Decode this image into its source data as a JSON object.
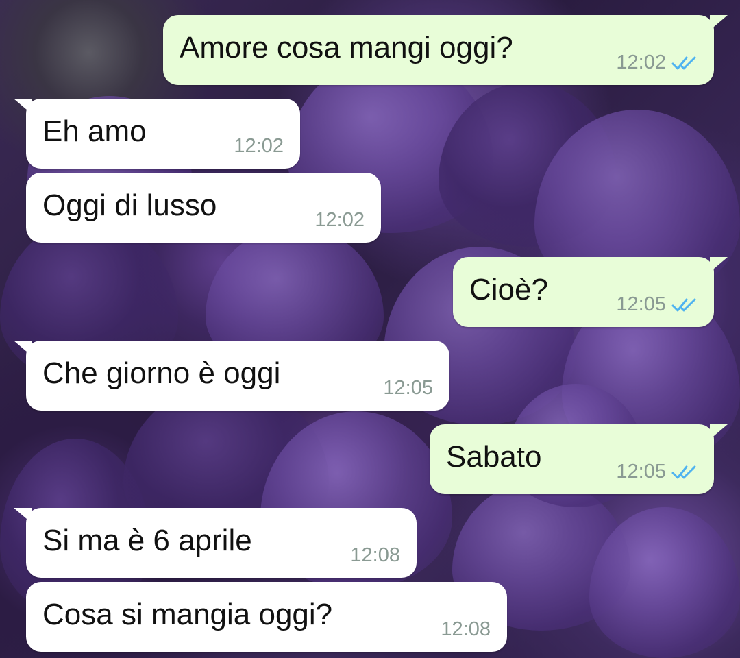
{
  "colors": {
    "incoming_bubble": "#ffffff",
    "outgoing_bubble": "#e8fdd8",
    "timestamp": "#8a9a93",
    "read_ticks": "#4fb3f0"
  },
  "messages": [
    {
      "direction": "out",
      "text": "Amore cosa mangi oggi?",
      "time": "12:02",
      "status_icon": "double-check-read-icon"
    },
    {
      "direction": "in",
      "text": "Eh amo",
      "time": "12:02"
    },
    {
      "direction": "in",
      "text": "Oggi di lusso",
      "time": "12:02"
    },
    {
      "direction": "out",
      "text": "Cioè?",
      "time": "12:05",
      "status_icon": "double-check-read-icon"
    },
    {
      "direction": "in",
      "text": "Che giorno è oggi",
      "time": "12:05"
    },
    {
      "direction": "out",
      "text": "Sabato",
      "time": "12:05",
      "status_icon": "double-check-read-icon"
    },
    {
      "direction": "in",
      "text": "Si ma è 6 aprile",
      "time": "12:08"
    },
    {
      "direction": "in",
      "text": "Cosa si mangia oggi?",
      "time": "12:08"
    }
  ]
}
